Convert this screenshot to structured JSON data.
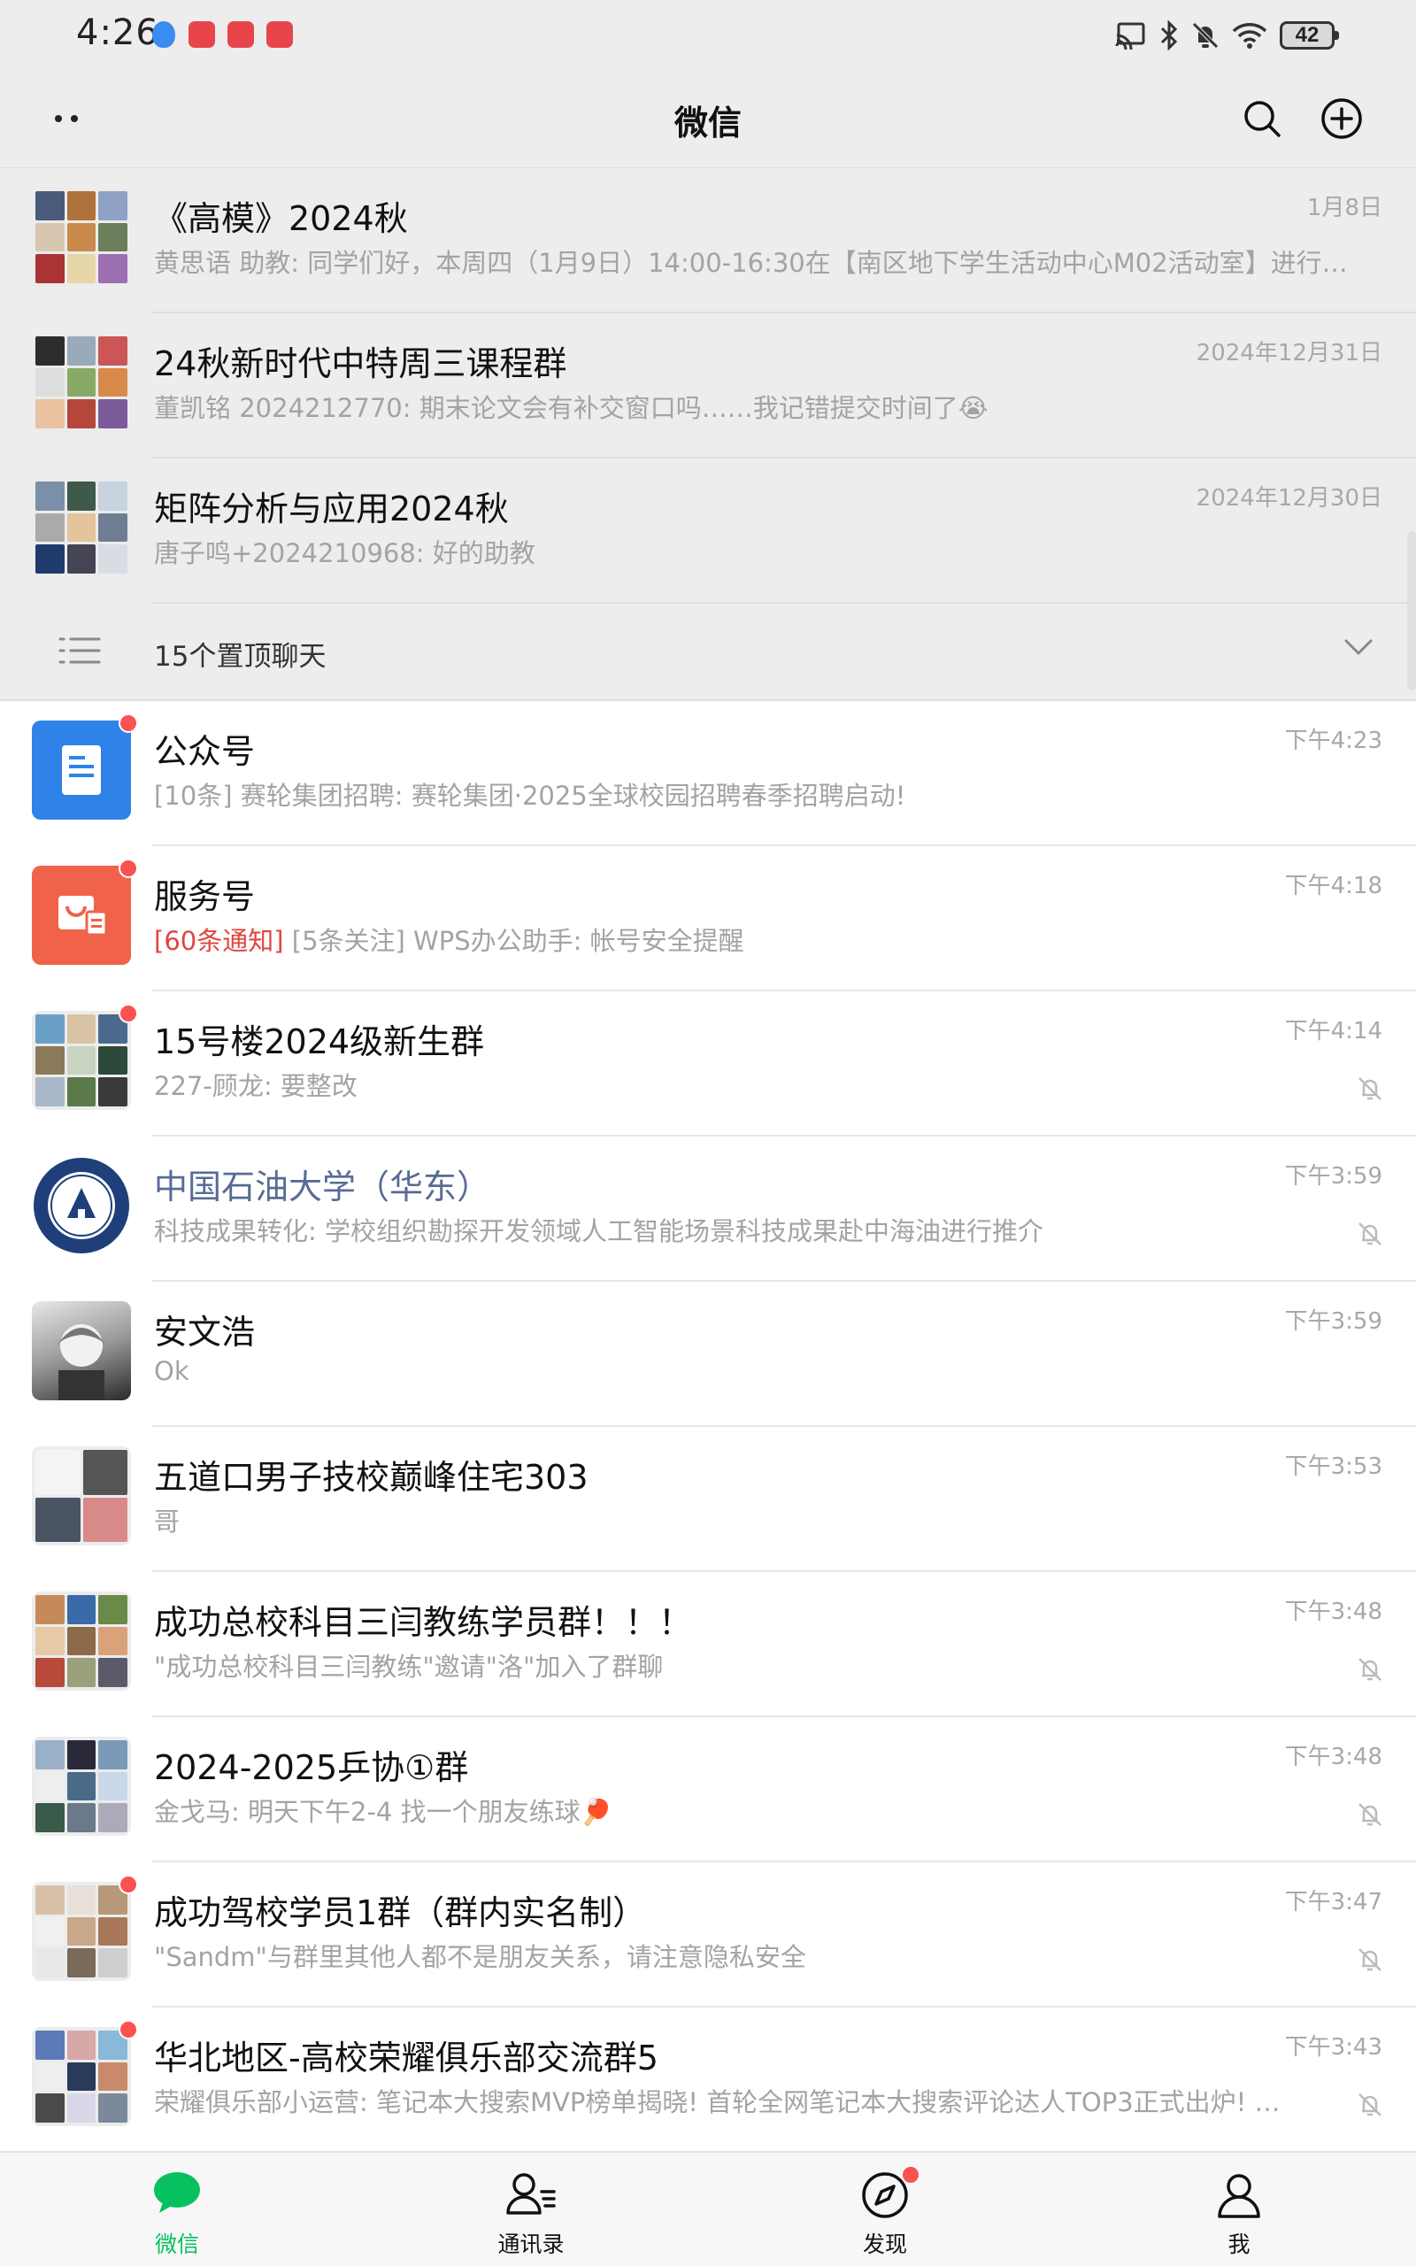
{
  "status_bar": {
    "time": "4:26",
    "battery": "42"
  },
  "header": {
    "title": "微信"
  },
  "pinned_chats": [
    {
      "name": "《高模》2024秋",
      "time": "1月8日",
      "preview": "黄思语 助教: 同学们好，本周四（1月9日）14:00-16:30在【南区地下学生活动中心M02活动室】进行…"
    },
    {
      "name": "24秋新时代中特周三课程群",
      "time": "2024年12月31日",
      "preview": "董凯铭 2024212770: 期末论文会有补交窗口吗……我记错提交时间了😭"
    },
    {
      "name": "矩阵分析与应用2024秋",
      "time": "2024年12月30日",
      "preview": "唐子鸣+2024210968: 好的助教"
    }
  ],
  "pinned_bar": {
    "label": "15个置顶聊天"
  },
  "chats": [
    {
      "name": "公众号",
      "time": "下午4:23",
      "preview": "[10条] 赛轮集团招聘: 赛轮集团·2025全球校园招聘春季招聘启动!"
    },
    {
      "name": "服务号",
      "time": "下午4:18",
      "preview_highlight": "[60条通知]",
      "preview": " [5条关注] WPS办公助手: 帐号安全提醒"
    },
    {
      "name": "15号楼2024级新生群",
      "time": "下午4:14",
      "preview": "227-顾龙: 要整改"
    },
    {
      "name": "中国石油大学（华东）",
      "time": "下午3:59",
      "preview": "科技成果转化: 学校组织勘探开发领域人工智能场景科技成果赴中海油进行推介"
    },
    {
      "name": "安文浩",
      "time": "下午3:59",
      "preview": "Ok"
    },
    {
      "name": "五道口男子技校巅峰住宅303",
      "time": "下午3:53",
      "preview": "哥"
    },
    {
      "name": "成功总校科目三闫教练学员群！！！",
      "time": "下午3:48",
      "preview": "\"成功总校科目三闫教练\"邀请\"洛\"加入了群聊"
    },
    {
      "name": "2024-2025乒协①群",
      "time": "下午3:48",
      "preview": "金戈马: 明天下午2-4 找一个朋友练球🏓"
    },
    {
      "name": "成功驾校学员1群（群内实名制）",
      "time": "下午3:47",
      "preview": "\"Sandm\"与群里其他人都不是朋友关系，请注意隐私安全"
    },
    {
      "name": "华北地区-高校荣耀俱乐部交流群5",
      "time": "下午3:43",
      "preview": "荣耀俱乐部小运营: 笔记本大搜索MVP榜单揭晓!  首轮全网笔记本大搜索评论达人TOP3正式出炉! …"
    }
  ],
  "tabs": [
    {
      "label": "微信"
    },
    {
      "label": "通讯录"
    },
    {
      "label": "发现"
    },
    {
      "label": "我"
    }
  ],
  "colors": {
    "accent": "#07c160",
    "badge": "#fa5151",
    "official_name": "#576b95",
    "header_bg": "#ededed"
  }
}
